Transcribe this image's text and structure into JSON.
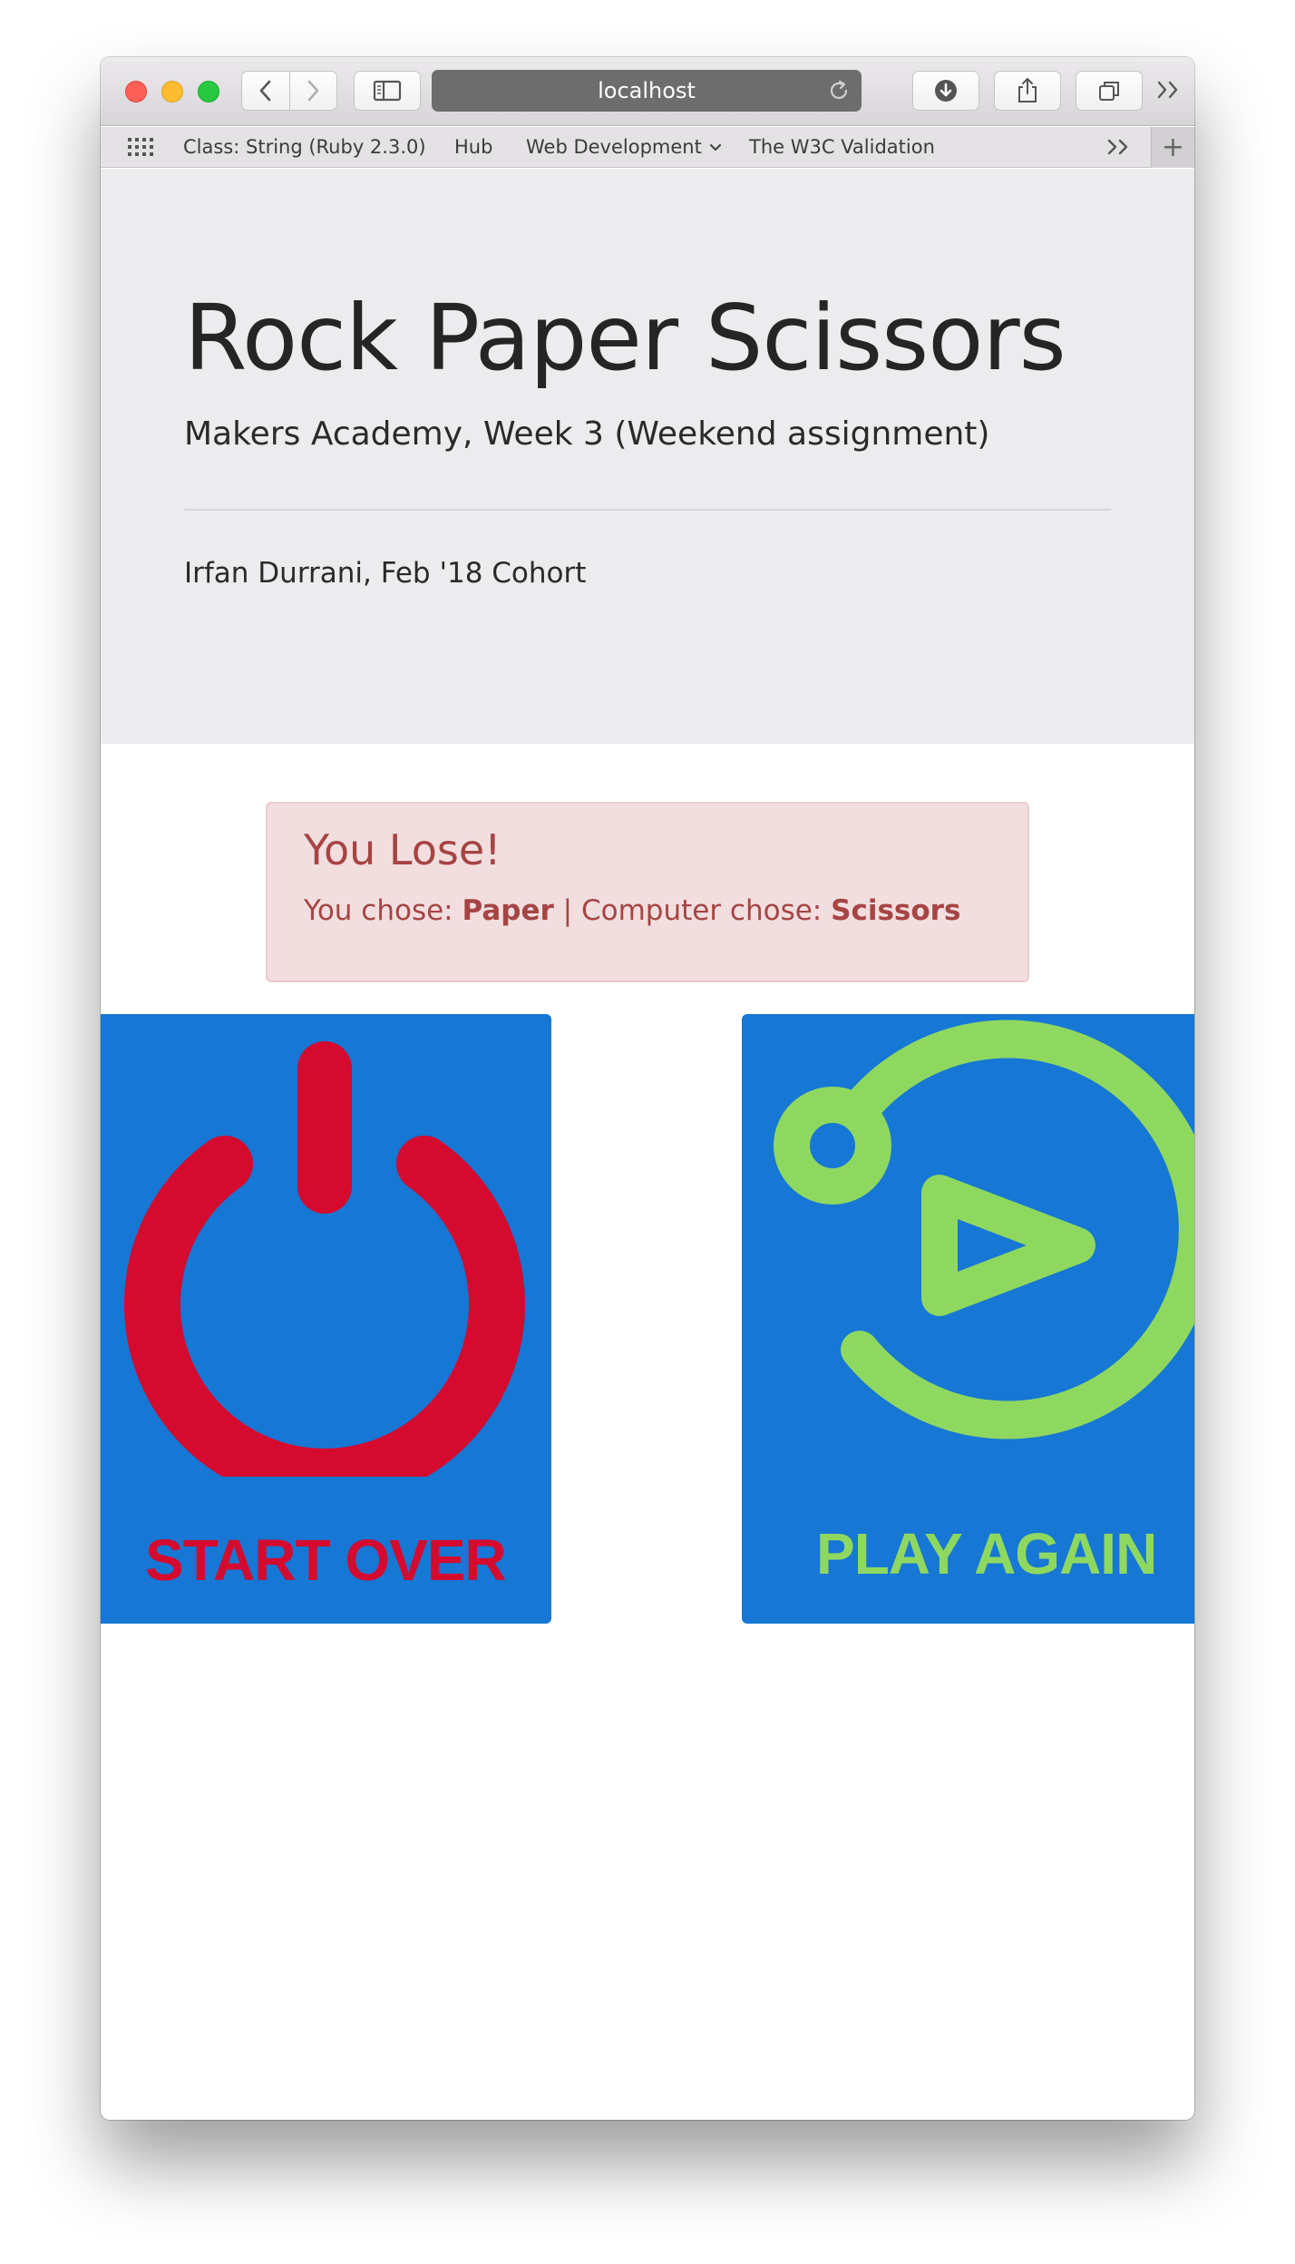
{
  "browser": {
    "url": "localhost",
    "bookmarks": [
      "Class: String (Ruby 2.3.0)",
      "Hub",
      "Web Development",
      "The W3C Validation"
    ]
  },
  "header": {
    "title": "Rock Paper Scissors",
    "subtitle": "Makers Academy, Week 3 (Weekend assignment)",
    "author": "Irfan Durrani, Feb '18 Cohort"
  },
  "result": {
    "heading": "You Lose!",
    "you_chose_label": "You chose:",
    "player_choice": "Paper",
    "separator": "|",
    "computer_chose_label": "Computer chose:",
    "computer_choice": "Scissors"
  },
  "actions": {
    "start_over_label": "START OVER",
    "play_again_label": "PLAY AGAIN"
  },
  "colors": {
    "card_background": "#1677d4",
    "start_over": "#d40a2f",
    "play_again": "#8fd860",
    "alert_text": "#a64444",
    "alert_background": "#f2dedf"
  }
}
